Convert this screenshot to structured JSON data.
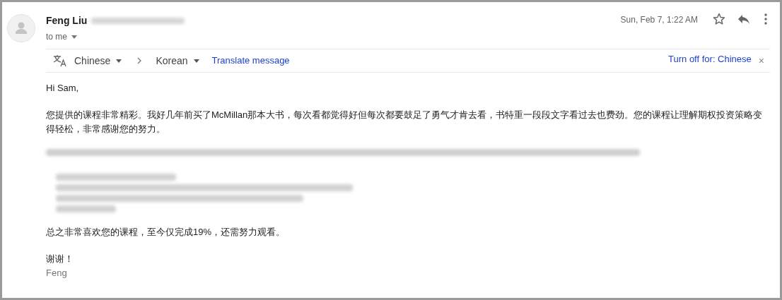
{
  "sender": {
    "name": "Feng Liu",
    "address_blurred": true,
    "recipient": "to me"
  },
  "date": "Sun, Feb 7, 1:22 AM",
  "starred": false,
  "translate_bar": {
    "from": "Chinese",
    "to": "Korean",
    "action": "Translate message",
    "turn_off": "Turn off for: Chinese",
    "close": "×"
  },
  "body": [
    {
      "kind": "text",
      "text": "Hi Sam,"
    },
    {
      "kind": "text",
      "text": "您提供的课程非常精彩。我好几年前买了McMillan那本大书，每次看都觉得好但每次都要鼓足了勇气才肯去看，书特重一段段文字看过去也费劲。您的课程让理解期权投资策略变得轻松，非常感谢您的努力。"
    },
    {
      "kind": "blurred"
    },
    {
      "kind": "blurred_list",
      "items": [
        {
          "kind": "blurred"
        },
        {
          "kind": "blurred"
        },
        {
          "kind": "blurred"
        },
        {
          "kind": "blurred"
        }
      ]
    },
    {
      "kind": "text",
      "text": "总之非常喜欢您的课程，至今仅完成19%，还需努力观看。"
    },
    {
      "kind": "signoff",
      "lines": [
        "谢谢！",
        "Feng"
      ]
    }
  ]
}
